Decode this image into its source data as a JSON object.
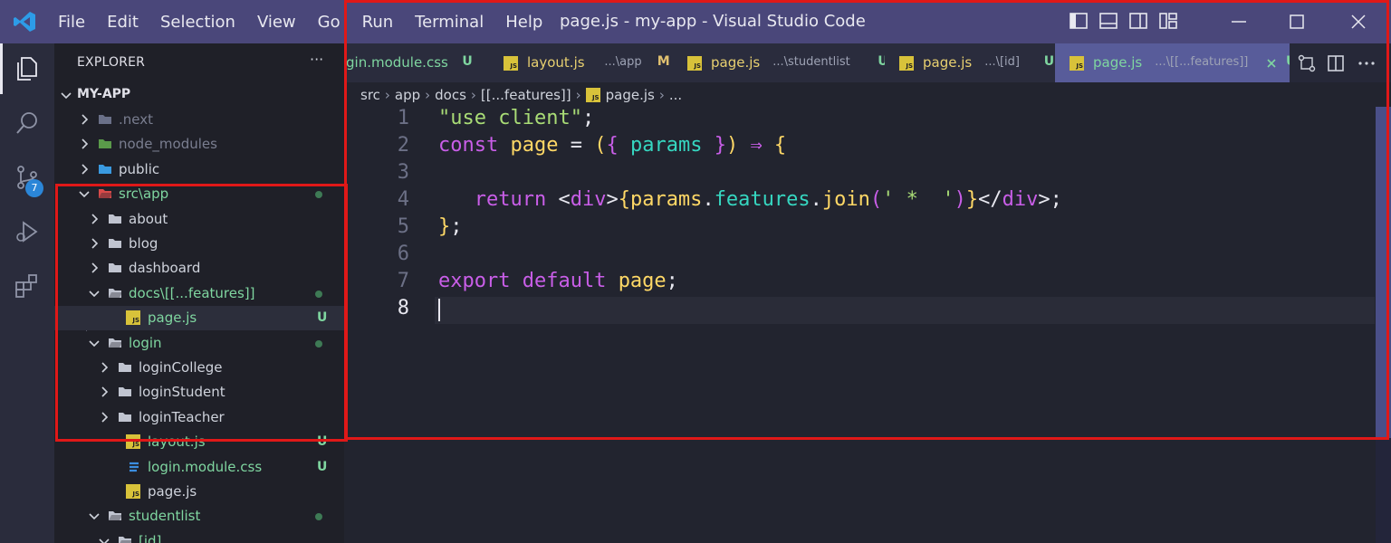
{
  "titlebar": {
    "menu": [
      "File",
      "Edit",
      "Selection",
      "View",
      "Go",
      "Run",
      "Terminal",
      "Help"
    ],
    "title": "page.js - my-app - Visual Studio Code",
    "brand_color": "#4a477a"
  },
  "activity_bar": {
    "icons": [
      "files-icon",
      "search-icon",
      "source-control-icon",
      "run-debug-icon",
      "extensions-icon"
    ],
    "scm_badge": "7"
  },
  "explorer": {
    "header": "EXPLORER",
    "more": "···",
    "root": "MY-APP",
    "tree": [
      {
        "label": ".next",
        "kind": "folder-next",
        "state": "closed",
        "depth": 0,
        "muted": true
      },
      {
        "label": "node_modules",
        "kind": "folder-node",
        "state": "closed",
        "depth": 0,
        "muted": true
      },
      {
        "label": "public",
        "kind": "folder-public",
        "state": "closed",
        "depth": 0
      },
      {
        "label": "src\\app",
        "kind": "folder-src",
        "state": "open",
        "depth": 0,
        "git": "dot"
      },
      {
        "label": "about",
        "kind": "folder",
        "state": "closed",
        "depth": 1
      },
      {
        "label": "blog",
        "kind": "folder",
        "state": "closed",
        "depth": 1
      },
      {
        "label": "dashboard",
        "kind": "folder",
        "state": "closed",
        "depth": 1
      },
      {
        "label": "docs\\[[...features]]",
        "kind": "folder",
        "state": "open",
        "depth": 1,
        "git": "dot",
        "untracked": true
      },
      {
        "label": "page.js",
        "kind": "js",
        "depth": 2,
        "git": "U",
        "selected": true
      },
      {
        "label": "login",
        "kind": "folder",
        "state": "open",
        "depth": 1,
        "git": "dot",
        "untracked": true
      },
      {
        "label": "loginCollege",
        "kind": "folder",
        "state": "closed",
        "depth": 2
      },
      {
        "label": "loginStudent",
        "kind": "folder",
        "state": "closed",
        "depth": 2
      },
      {
        "label": "loginTeacher",
        "kind": "folder",
        "state": "closed",
        "depth": 2
      },
      {
        "label": "layout.js",
        "kind": "js",
        "depth": 2,
        "git": "U",
        "untracked": true
      },
      {
        "label": "login.module.css",
        "kind": "css",
        "depth": 2,
        "git": "U",
        "untracked": true
      },
      {
        "label": "page.js",
        "kind": "js",
        "depth": 2
      },
      {
        "label": "studentlist",
        "kind": "folder",
        "state": "open",
        "depth": 1,
        "git": "dot",
        "untracked": true
      },
      {
        "label": "[id]",
        "kind": "folder",
        "state": "open",
        "depth": 2,
        "untracked": true
      }
    ]
  },
  "tabs": [
    {
      "name": "gin.module.css",
      "dir": "",
      "status": "U",
      "icon": "css"
    },
    {
      "name": "layout.js",
      "dir": "...\\app",
      "status": "M",
      "icon": "js"
    },
    {
      "name": "page.js",
      "dir": "...\\studentlist",
      "status": "U",
      "icon": "js"
    },
    {
      "name": "page.js",
      "dir": "...\\[id]",
      "status": "U",
      "icon": "js"
    },
    {
      "name": "page.js",
      "dir": "...\\[[...features]]",
      "status": "U",
      "icon": "js",
      "active": true
    }
  ],
  "breadcrumbs": [
    "src",
    "app",
    "docs",
    "[[...features]]",
    "page.js",
    "..."
  ],
  "editor": {
    "current_line": 8,
    "lines": [
      [
        [
          "\"use client\"",
          "#a9dc76"
        ],
        [
          ";",
          "#e8e8f0"
        ]
      ],
      [
        [
          "const ",
          "#c95ee8"
        ],
        [
          "page",
          "#ffd866"
        ],
        [
          " = ",
          "#e8e8f0"
        ],
        [
          "(",
          "#ffd866"
        ],
        [
          "{",
          "#c95ee8"
        ],
        [
          " params ",
          "#36d7c1"
        ],
        [
          "}",
          "#c95ee8"
        ],
        [
          ") ",
          "#ffd866"
        ],
        [
          "⇒",
          "#c95ee8"
        ],
        [
          " {",
          "#ffd866"
        ]
      ],
      [],
      [
        [
          "   return ",
          "#c95ee8"
        ],
        [
          "<",
          "#e8e8f0"
        ],
        [
          "div",
          "#c95ee8"
        ],
        [
          ">",
          "#e8e8f0"
        ],
        [
          "{",
          "#ffd866"
        ],
        [
          "params",
          "#ffd866"
        ],
        [
          ".",
          "#e8e8f0"
        ],
        [
          "features",
          "#36d7c1"
        ],
        [
          ".",
          "#e8e8f0"
        ],
        [
          "join",
          "#ffd866"
        ],
        [
          "(",
          "#c95ee8"
        ],
        [
          "' *  '",
          "#a9dc76"
        ],
        [
          ")",
          "#c95ee8"
        ],
        [
          "}",
          "#ffd866"
        ],
        [
          "</",
          "#e8e8f0"
        ],
        [
          "div",
          "#c95ee8"
        ],
        [
          ">",
          "#e8e8f0"
        ],
        [
          ";",
          "#e8e8f0"
        ]
      ],
      [
        [
          "}",
          "#ffd866"
        ],
        [
          ";",
          "#e8e8f0"
        ]
      ],
      [],
      [
        [
          "export default ",
          "#c95ee8"
        ],
        [
          "page",
          "#ffd866"
        ],
        [
          ";",
          "#e8e8f0"
        ]
      ],
      []
    ]
  }
}
